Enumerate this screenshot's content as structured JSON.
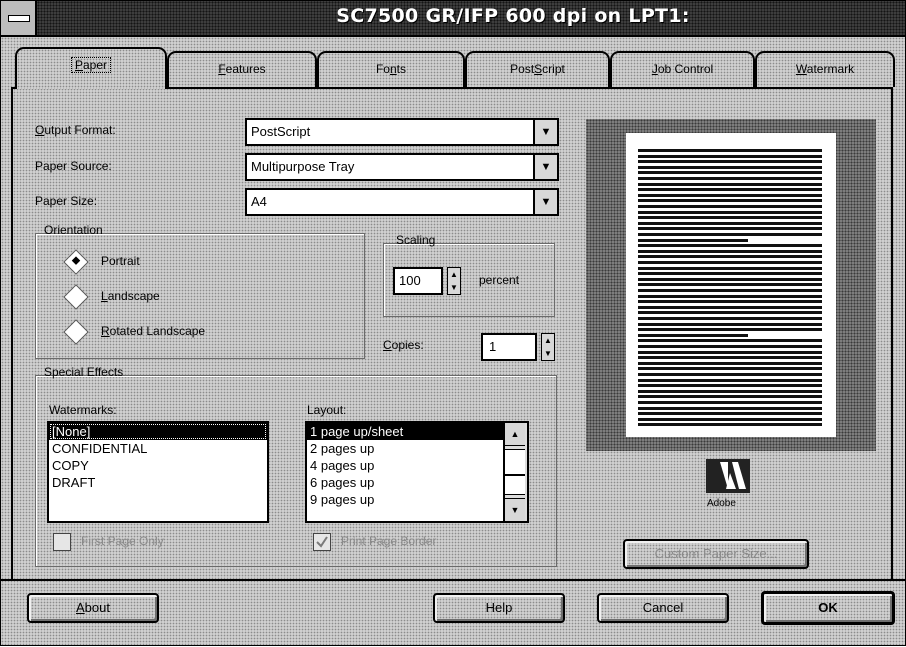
{
  "window": {
    "title": "SC7500 GR/IFP 600 dpi on LPT1:"
  },
  "tabs": [
    {
      "label": "Paper",
      "key": "P",
      "rest": "aper"
    },
    {
      "label": "Features",
      "key": "F",
      "rest": "eatures"
    },
    {
      "label": "Fonts",
      "pre": "Fo",
      "key": "n",
      "rest": "ts"
    },
    {
      "label": "PostScript",
      "pre": "Post",
      "key": "S",
      "rest": "cript"
    },
    {
      "label": "Job Control",
      "key": "J",
      "rest": "ob Control"
    },
    {
      "label": "Watermark",
      "key": "W",
      "rest": "atermark"
    }
  ],
  "paper": {
    "output_format_label_key": "O",
    "output_format_label_rest": "utput Format:",
    "output_format": "PostScript",
    "paper_source_label": "Paper Source:",
    "paper_source": "Multipurpose Tray",
    "paper_size_label": "Paper Size:",
    "paper_size": "A4",
    "orientation_title": "Orientation",
    "orientation": [
      {
        "label": "Portrait",
        "selected": true
      },
      {
        "label": "Landscape",
        "key": "L",
        "rest": "andscape",
        "selected": false
      },
      {
        "label": "Rotated Landscape",
        "key": "R",
        "rest": "otated Landscape",
        "selected": false
      }
    ],
    "scaling_title": "Scaling",
    "scaling_value": "100",
    "scaling_unit": "percent",
    "copies_label_key": "C",
    "copies_label_rest": "opies:",
    "copies_value": "1"
  },
  "special_effects": {
    "title": "Special Effects",
    "watermarks_label": "Watermarks:",
    "watermarks": [
      "[None]",
      "CONFIDENTIAL",
      "COPY",
      "DRAFT"
    ],
    "watermark_selected": 0,
    "first_page_only": "First Page Only",
    "layout_label": "Layout:",
    "layout": [
      "1 page up/sheet",
      "2 pages up",
      "4 pages up",
      "6 pages up",
      "9 pages up"
    ],
    "layout_selected": 0,
    "print_page_border": "Print Page Border"
  },
  "preview": {
    "logo_text": "Adobe",
    "button": "Custom Paper Size..."
  },
  "buttons": {
    "about": "About",
    "about_key": "A",
    "about_rest": "bout",
    "help": "Help",
    "cancel": "Cancel",
    "ok": "OK"
  },
  "colors": {
    "title_bar": "#3d3d3d",
    "dialog_bg": "#cfcfcf",
    "selection": "#000000",
    "preview_surround": "#7d7d7d"
  }
}
